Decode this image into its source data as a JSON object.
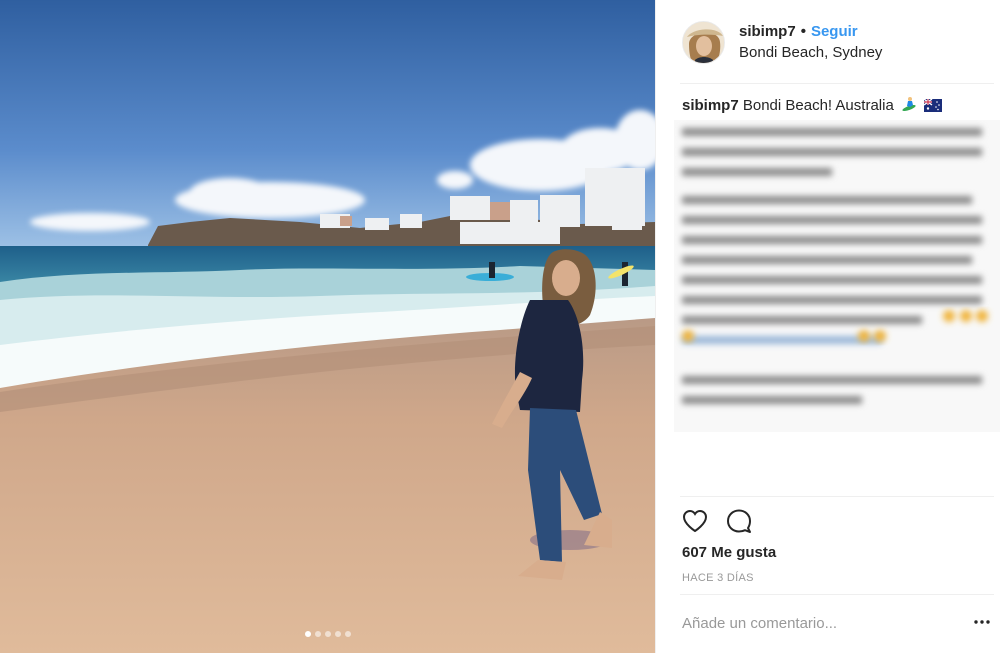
{
  "photo": {
    "alt": "",
    "carousel_count": 5,
    "carousel_active": 0
  },
  "header": {
    "username": "sibimp7",
    "separator": "•",
    "follow_label": "Seguir",
    "location": "Bondi Beach, Sydney"
  },
  "caption": {
    "username": "sibimp7",
    "text": "Bondi Beach! Australia",
    "emojis": [
      "surfer-emoji",
      "australia-flag-emoji"
    ]
  },
  "actions": {
    "like_icon": "heart-icon",
    "comment_icon": "comment-icon"
  },
  "likes": "607 Me gusta",
  "timestamp": "HACE 3 DÍAS",
  "comment_input": {
    "placeholder": "Añade un comentario...",
    "value": ""
  },
  "more_icon": "ellipsis-icon",
  "colors": {
    "accent": "#3897f0",
    "text": "#262626",
    "muted": "#999999",
    "divider": "#efefef"
  }
}
